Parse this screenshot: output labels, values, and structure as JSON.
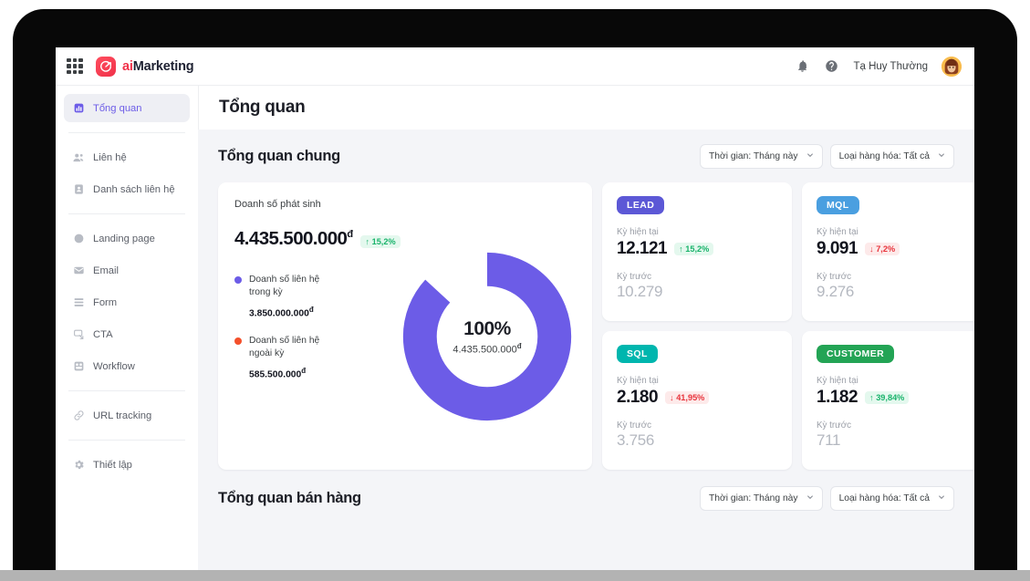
{
  "header": {
    "logo_ai": "ai",
    "logo_marketing": "Marketing",
    "apps_icon": "apps-grid-icon",
    "bell_icon": "bell-icon",
    "help_icon": "help-circle-icon",
    "user_name": "Tạ Huy Thường",
    "avatar_icon": "user-avatar"
  },
  "sidebar": {
    "items": [
      {
        "label": "Tổng quan",
        "icon": "dashboard-icon",
        "active": true
      },
      {
        "label": "Liên hệ",
        "icon": "contacts-icon",
        "active": false
      },
      {
        "label": "Danh sách liên hệ",
        "icon": "contact-list-icon",
        "active": false
      },
      {
        "label": "Landing page",
        "icon": "landing-page-icon",
        "active": false
      },
      {
        "label": "Email",
        "icon": "email-icon",
        "active": false
      },
      {
        "label": "Form",
        "icon": "form-icon",
        "active": false
      },
      {
        "label": "CTA",
        "icon": "cta-icon",
        "active": false
      },
      {
        "label": "Workflow",
        "icon": "workflow-icon",
        "active": false
      },
      {
        "label": "URL tracking",
        "icon": "link-icon",
        "active": false
      },
      {
        "label": "Thiết lập",
        "icon": "settings-gear-icon",
        "active": false
      }
    ]
  },
  "page": {
    "title": "Tổng quan"
  },
  "section_overview": {
    "title": "Tổng quan chung",
    "filter_time": "Thời gian: Tháng này",
    "filter_product": "Loại hàng hóa: Tất cả",
    "caret": "⌄"
  },
  "section_sales": {
    "title": "Tổng quan bán hàng",
    "filter_time": "Thời gian: Tháng này",
    "filter_product": "Loại hàng hóa: Tất cả",
    "caret": "⌄"
  },
  "revenue_card": {
    "label": "Doanh số phát sinh",
    "value": "4.435.500.000",
    "currency": "đ",
    "delta": "↑ 15,2%",
    "delta_dir": "up",
    "legend": [
      {
        "name": "Doanh số liên hệ trong kỳ",
        "value": "3.850.000.000",
        "currency": "đ",
        "color": "#6c5ce7"
      },
      {
        "name": "Doanh số liên hệ ngoài kỳ",
        "value": "585.500.000",
        "currency": "đ",
        "color": "#f4502b"
      }
    ],
    "center_percent": "100%",
    "center_value": "4.435.500.000",
    "center_currency": "đ"
  },
  "metric_cards": [
    {
      "badge": "LEAD",
      "badge_color": "#5c58d6",
      "current_label": "Kỳ hiện tại",
      "current_value": "12.121",
      "delta": "↑ 15,2%",
      "delta_dir": "up",
      "prev_label": "Kỳ trước",
      "prev_value": "10.279"
    },
    {
      "badge": "MQL",
      "badge_color": "#4a9fe0",
      "current_label": "Kỳ hiện tại",
      "current_value": "9.091",
      "delta": "↓ 7,2%",
      "delta_dir": "down",
      "prev_label": "Kỳ trước",
      "prev_value": "9.276"
    },
    {
      "badge": "SQL",
      "badge_color": "#00b6ae",
      "current_label": "Kỳ hiện tại",
      "current_value": "2.180",
      "delta": "↓ 41,95%",
      "delta_dir": "down",
      "prev_label": "Kỳ trước",
      "prev_value": "3.756"
    },
    {
      "badge": "CUSTOMER",
      "badge_color": "#23a455",
      "current_label": "Kỳ hiện tại",
      "current_value": "1.182",
      "delta": "↑ 39,84%",
      "delta_dir": "up",
      "prev_label": "Kỳ trước",
      "prev_value": "711"
    }
  ],
  "chart_data": {
    "type": "pie",
    "title": "Doanh số phát sinh",
    "labels": [
      "Doanh số liên hệ trong kỳ",
      "Doanh số liên hệ ngoài kỳ"
    ],
    "values": [
      3850000000,
      585500000
    ],
    "percentages": [
      86.8,
      13.2
    ],
    "colors": [
      "#6c5ce7",
      "#f4502b"
    ],
    "total": 4435500000,
    "total_display": "4.435.500.000đ",
    "center_label": "100%",
    "donut": true,
    "inner_radius_ratio": 0.6,
    "legend_position": "left",
    "start_angle_deg": 0,
    "direction": "counterclockwise-for-red"
  }
}
